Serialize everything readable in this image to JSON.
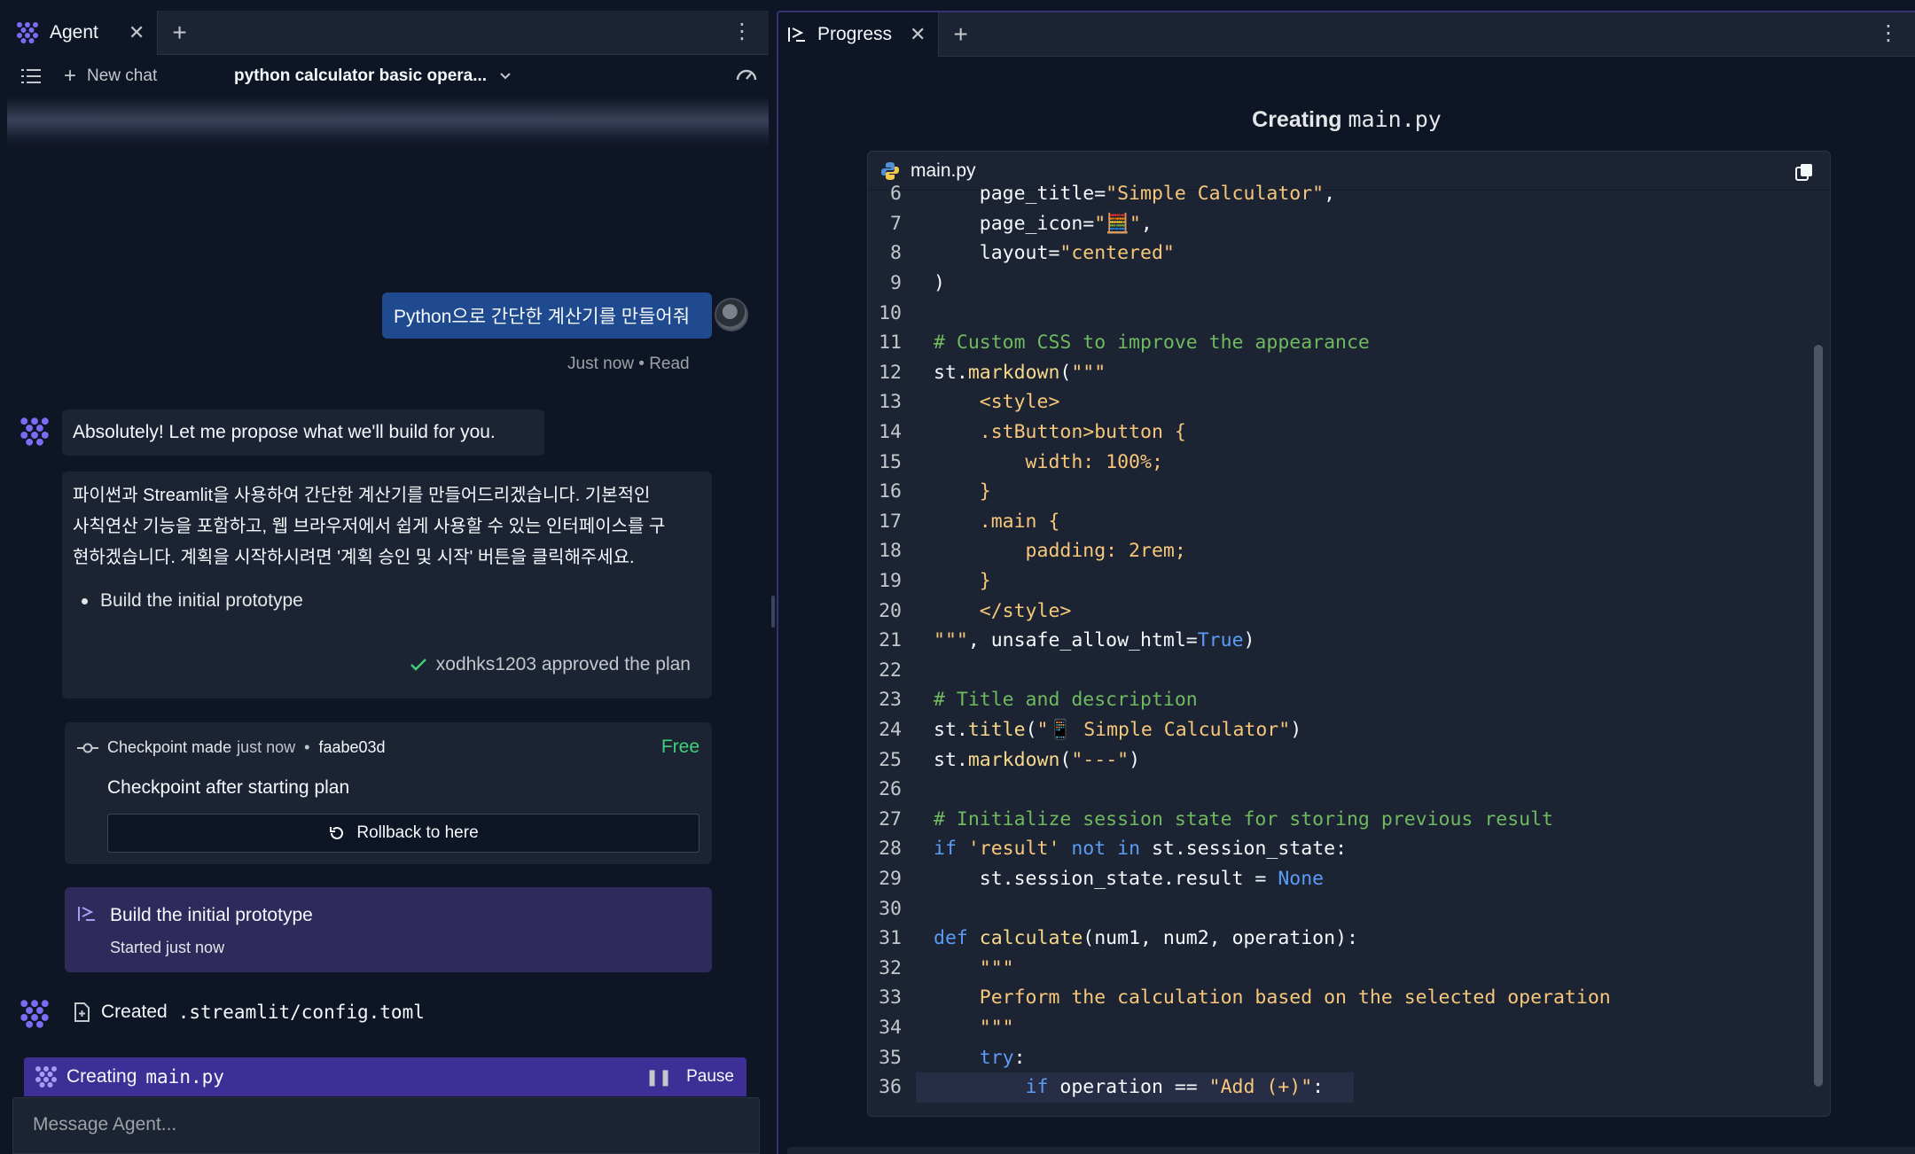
{
  "left": {
    "tab_label": "Agent",
    "new_chat_label": "New chat",
    "chat_title": "python calculator basic opera...",
    "user_message": "Python으로 간단한 계산기를 만들어줘",
    "message_meta": "Just now • Read",
    "agent_reply": "Absolutely! Let me propose what we'll build for you.",
    "plan_text": [
      "파이썬과 Streamlit을 사용하여 간단한 계산기를 만들어드리겠습니다. 기본적인",
      "사칙연산 기능을 포함하고, 웹 브라우저에서 쉽게 사용할 수 있는 인터페이스를 구",
      "현하겠습니다. 계획을 시작하시려면 '계획 승인 및 시작' 버튼을 클릭해주세요."
    ],
    "plan_bullet": "Build the initial prototype",
    "approved_text": "xodhks1203 approved the plan",
    "checkpoint": {
      "label": "Checkpoint made",
      "time": "just now",
      "sep": "•",
      "hash": "faabe03d",
      "price": "Free",
      "title": "Checkpoint after starting plan",
      "rollback_label": "Rollback to here"
    },
    "task": {
      "title": "Build the initial prototype",
      "status": "Started just now"
    },
    "created_prefix": "Created",
    "created_file": ".streamlit/config.toml",
    "creating_prefix": "Creating",
    "creating_file": "main.py",
    "pause_label": "Pause",
    "input_placeholder": "Message Agent..."
  },
  "right": {
    "tab_label": "Progress",
    "heading_prefix": "Creating",
    "heading_file": "main.py",
    "editor_filename": "main.py"
  },
  "code_lines": [
    {
      "n": "6",
      "html": "    page_title=<span class=\"str\">\"Simple Calculator\"</span>,"
    },
    {
      "n": "7",
      "html": "    page_icon=<span class=\"str\">\"🧮\"</span>,"
    },
    {
      "n": "8",
      "html": "    layout=<span class=\"str\">\"centered\"</span>"
    },
    {
      "n": "9",
      "html": ")"
    },
    {
      "n": "10",
      "html": ""
    },
    {
      "n": "11",
      "html": "<span class=\"cm\"># Custom CSS to improve the appearance</span>"
    },
    {
      "n": "12",
      "html": "st.<span class=\"fn\">markdown</span>(<span class=\"str\">\"\"\"</span>"
    },
    {
      "n": "13",
      "html": "<span class=\"str\">    &lt;style&gt;</span>"
    },
    {
      "n": "14",
      "html": "<span class=\"str\">    .stButton&gt;button {</span>"
    },
    {
      "n": "15",
      "html": "<span class=\"str\">        width: 100%;</span>"
    },
    {
      "n": "16",
      "html": "<span class=\"str\">    }</span>"
    },
    {
      "n": "17",
      "html": "<span class=\"str\">    .main {</span>"
    },
    {
      "n": "18",
      "html": "<span class=\"str\">        padding: 2rem;</span>"
    },
    {
      "n": "19",
      "html": "<span class=\"str\">    }</span>"
    },
    {
      "n": "20",
      "html": "<span class=\"str\">    &lt;/style&gt;</span>"
    },
    {
      "n": "21",
      "html": "<span class=\"str\">\"\"\"</span>, unsafe_allow_html=<span class=\"kw\">True</span>)"
    },
    {
      "n": "22",
      "html": ""
    },
    {
      "n": "23",
      "html": "<span class=\"cm\"># Title and description</span>"
    },
    {
      "n": "24",
      "html": "st.<span class=\"fn\">title</span>(<span class=\"str\">\"📱 Simple Calculator\"</span>)"
    },
    {
      "n": "25",
      "html": "st.<span class=\"fn\">markdown</span>(<span class=\"str\">\"---\"</span>)"
    },
    {
      "n": "26",
      "html": ""
    },
    {
      "n": "27",
      "html": "<span class=\"cm\"># Initialize session state for storing previous result</span>"
    },
    {
      "n": "28",
      "html": "<span class=\"kw\">if</span> <span class=\"str\">'result'</span> <span class=\"kw\">not in</span> st.session_state:"
    },
    {
      "n": "29",
      "html": "    st.session_state.result = <span class=\"kw\">None</span>"
    },
    {
      "n": "30",
      "html": ""
    },
    {
      "n": "31",
      "html": "<span class=\"kw\">def</span> <span class=\"fn\">calculate</span>(num1, num2, operation):"
    },
    {
      "n": "32",
      "html": "<span class=\"str\">    \"\"\"</span>"
    },
    {
      "n": "33",
      "html": "<span class=\"str\">    Perform the calculation based on the selected operation</span>"
    },
    {
      "n": "34",
      "html": "<span class=\"str\">    \"\"\"</span>"
    },
    {
      "n": "35",
      "html": "    <span class=\"kw\">try</span>:"
    },
    {
      "n": "36",
      "html": "        <span class=\"kw\">if</span> operation == <span class=\"str\">\"Add (+)\"</span>:"
    }
  ],
  "colors": {
    "bg": "#0e1525",
    "panel": "#1c2333",
    "user_bubble": "#1f4a8f",
    "plan_card": "#2e2b5c",
    "creating_bar": "#3d2f96",
    "accent_purple": "#7c6cf5",
    "free_green": "#3fd17a"
  },
  "icons": [
    "agent-logo-icon",
    "close-icon",
    "plus-icon",
    "kebab-icon",
    "list-icon",
    "chevron-down-icon",
    "gauge-icon",
    "check-icon",
    "commit-icon",
    "rollback-icon",
    "task-icon",
    "file-icon",
    "python-icon",
    "copy-icon",
    "pause-icon"
  ]
}
